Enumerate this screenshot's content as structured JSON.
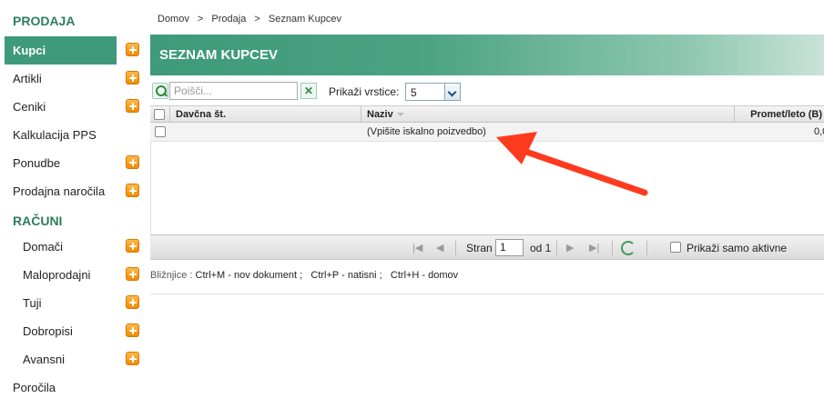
{
  "sidebar": {
    "section_sales": "PRODAJA",
    "section_accounts": "RAČUNI",
    "items": [
      {
        "label": "Kupci",
        "plus": true
      },
      {
        "label": "Artikli",
        "plus": true
      },
      {
        "label": "Ceniki",
        "plus": true
      },
      {
        "label": "Kalkulacija PPS",
        "plus": false
      },
      {
        "label": "Ponudbe",
        "plus": true
      },
      {
        "label": "Prodajna naročila",
        "plus": true
      }
    ],
    "sub_items": [
      {
        "label": "Domači",
        "plus": true
      },
      {
        "label": "Maloprodajni",
        "plus": true
      },
      {
        "label": "Tuji",
        "plus": true
      },
      {
        "label": "Dobropisi",
        "plus": true
      },
      {
        "label": "Avansni",
        "plus": true
      }
    ],
    "footer_item": "Poročila"
  },
  "breadcrumb": [
    "Domov",
    ">",
    "Prodaja",
    ">",
    "Seznam Kupcev"
  ],
  "header": {
    "title": "SEZNAM KUPCEV"
  },
  "toolbar": {
    "search_placeholder": "Poišči...",
    "rows_label": "Prikaži vrstice:",
    "rows_value": "5"
  },
  "grid": {
    "columns": [
      "Davčna št.",
      "Naziv",
      "Promet/leto (B)"
    ],
    "rows": [
      {
        "tax": "",
        "name": "(Vpišite iskalno poizvedbo)",
        "turnover": "0,0"
      }
    ]
  },
  "pager": {
    "page_label": "Stran",
    "page_value": "1",
    "of_label": "od 1",
    "active_only": "Prikaži samo aktivne"
  },
  "shortcuts": {
    "label": "Bližnjice :",
    "items": "Ctrl+M - nov dokument ;   Ctrl+P - natisni ;   Ctrl+H - domov"
  },
  "colors": {
    "accent": "#3e9a7a",
    "plus": "#f08a00",
    "annotation": "#ff3b1f"
  },
  "icons": [
    "plus-icon",
    "search-icon",
    "clear-icon",
    "chevron-down-icon",
    "first-page-icon",
    "prev-page-icon",
    "next-page-icon",
    "last-page-icon",
    "refresh-icon",
    "arrow-annotation"
  ]
}
